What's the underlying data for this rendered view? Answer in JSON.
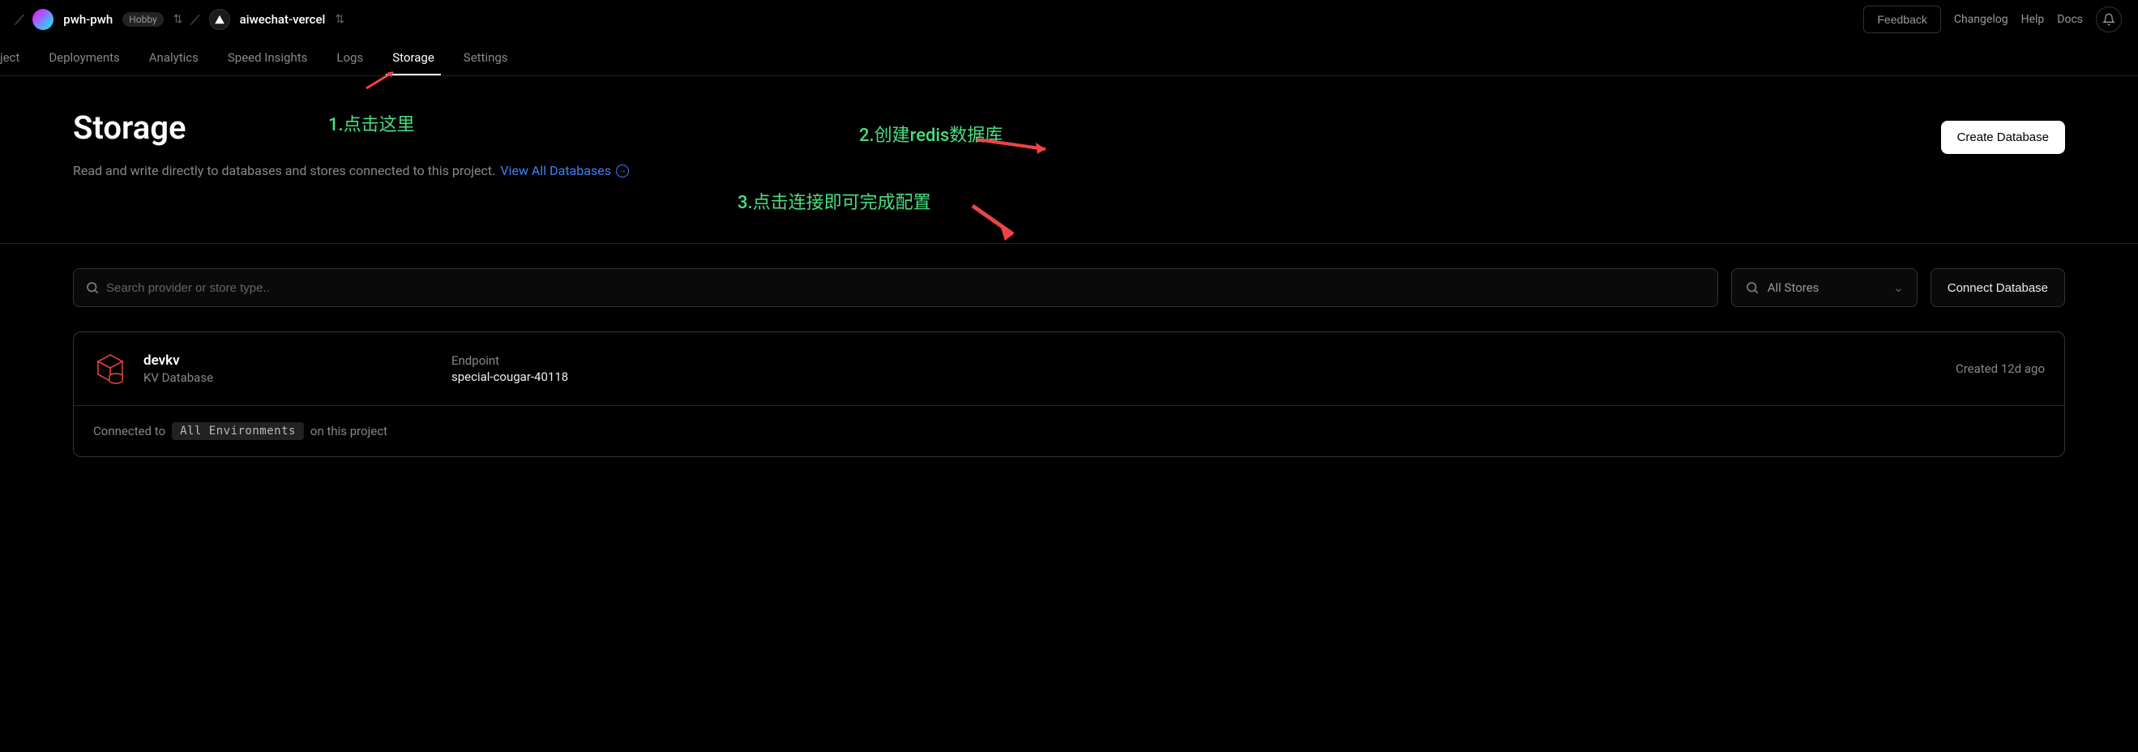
{
  "breadcrumb": {
    "org": "pwh-pwh",
    "badge": "Hobby",
    "project": "aiwechat-vercel"
  },
  "topnav": {
    "feedback": "Feedback",
    "changelog": "Changelog",
    "help": "Help",
    "docs": "Docs"
  },
  "tabs": {
    "partial": "ject",
    "deployments": "Deployments",
    "analytics": "Analytics",
    "speed": "Speed Insights",
    "logs": "Logs",
    "storage": "Storage",
    "settings": "Settings"
  },
  "page": {
    "title": "Storage",
    "desc": "Read and write directly to databases and stores connected to this project.",
    "viewAll": "View All Databases",
    "createBtn": "Create Database"
  },
  "search": {
    "placeholder": "Search provider or store type..",
    "storesFilter": "All Stores",
    "connectBtn": "Connect Database"
  },
  "db": {
    "name": "devkv",
    "type": "KV Database",
    "endpointLabel": "Endpoint",
    "endpointValue": "special-cougar-40118",
    "created": "Created 12d ago",
    "connectedPrefix": "Connected to",
    "envTag": "All Environments",
    "connectedSuffix": "on this project"
  },
  "annotations": {
    "a1": "1.点击这里",
    "a2": "2.创建redis数据库",
    "a3": "3.点击连接即可完成配置"
  }
}
